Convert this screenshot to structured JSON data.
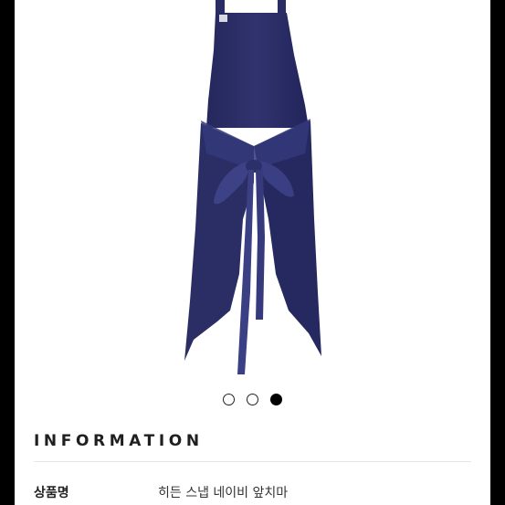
{
  "carousel": {
    "total": 3,
    "active_index": 3
  },
  "product_image": {
    "subject": "apron",
    "color": "#2a2d63"
  },
  "information": {
    "heading": "INFORMATION",
    "rows": [
      {
        "label": "상품명",
        "value": "히든 스냅 네이비 앞치마"
      }
    ]
  }
}
